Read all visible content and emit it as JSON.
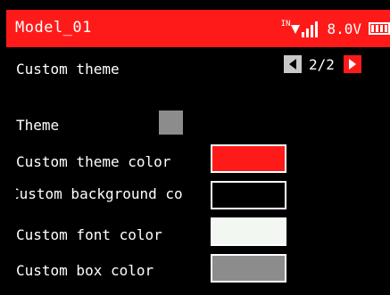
{
  "header": {
    "model_name": "Model_01",
    "signal_prefix": "IN",
    "voltage": "8.0V",
    "bg_color": "#ff1a1a",
    "signal_icon": "signal-bars-icon",
    "battery_icon": "battery-icon"
  },
  "page": {
    "title": "Custom theme",
    "indicator": "2/2",
    "prev_icon": "arrow-left-icon",
    "next_icon": "arrow-right-icon"
  },
  "settings": [
    {
      "label": "Theme",
      "color": "#8c8c8c"
    },
    {
      "label": "Custom theme color",
      "color": "#ff1a1a"
    },
    {
      "label": "Custom background co",
      "color": "#000000"
    },
    {
      "label": "Custom font color",
      "color": "#f2f7f2"
    },
    {
      "label": "Custom box color",
      "color": "#8c8c8c"
    }
  ]
}
